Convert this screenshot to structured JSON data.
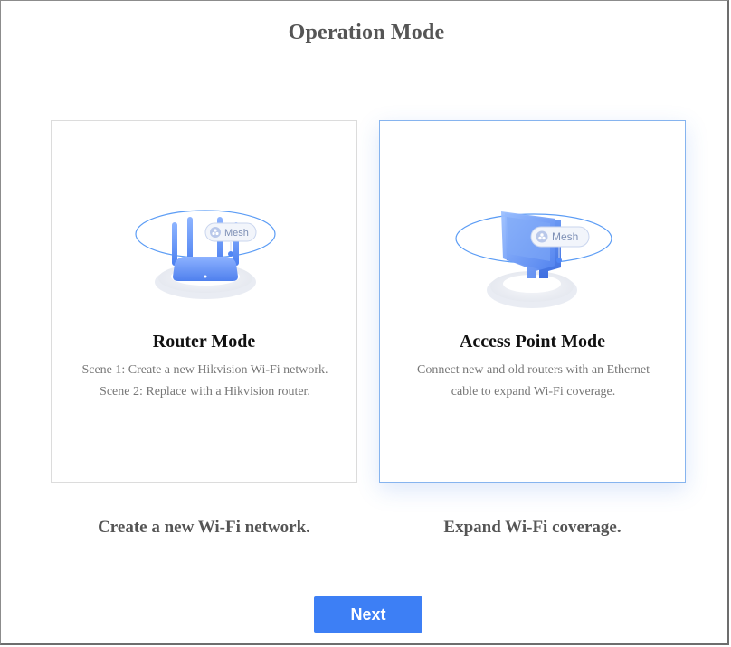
{
  "header": {
    "title": "Operation Mode"
  },
  "cards": [
    {
      "id": "router",
      "title": "Router Mode",
      "badge": "Mesh",
      "description": [
        "Scene 1: Create a new Hikvision Wi-Fi network.",
        "Scene 2: Replace with a Hikvision router."
      ],
      "caption": "Create a new Wi-Fi network.",
      "selected": false
    },
    {
      "id": "access-point",
      "title": "Access Point Mode",
      "badge": "Mesh",
      "description": [
        "Connect new and old routers with an Ethernet",
        "cable to expand Wi-Fi coverage."
      ],
      "caption": "Expand Wi-Fi coverage.",
      "selected": true
    }
  ],
  "footer": {
    "next_label": "Next"
  },
  "colors": {
    "accent": "#3d7ff5",
    "selected_border": "#86b4ef",
    "title_text": "#555555"
  },
  "icons": [
    "router-illustration",
    "access-point-illustration",
    "mesh-icon"
  ]
}
